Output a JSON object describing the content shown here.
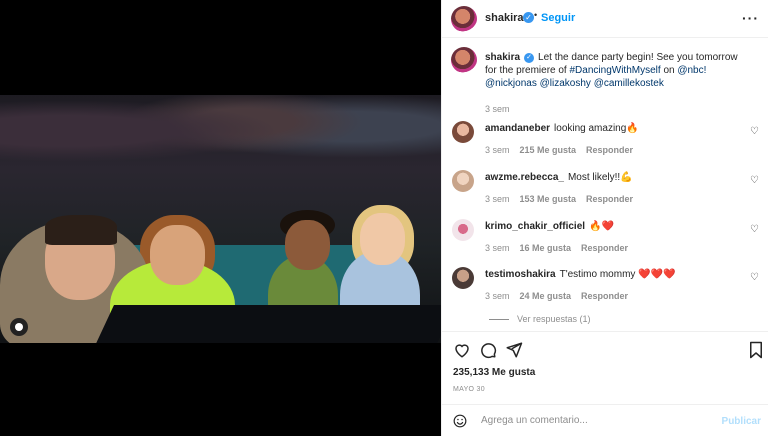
{
  "post": {
    "username": "shakira",
    "follow_label": "Seguir",
    "separator": "•",
    "more_label": "···"
  },
  "caption": {
    "username": "shakira",
    "text": "Let the dance party begin! See you tomorrow for the premiere of",
    "hashtag": "#DancingWithMyself",
    "on": "on",
    "mention_nbc": "@nbc!",
    "mention_nick": "@nickjonas",
    "mention_liza": "@lizakoshy",
    "mention_camille": "@camillekostek",
    "time": "3 sem"
  },
  "comments": [
    {
      "user": "amandaneber",
      "text": "looking amazing🔥",
      "time": "3 sem",
      "likes": "215 Me gusta",
      "reply": "Responder"
    },
    {
      "user": "awzme.rebecca_",
      "text": "Most likely!!💪",
      "time": "3 sem",
      "likes": "153 Me gusta",
      "reply": "Responder"
    },
    {
      "user": "krimo_chakir_officiel",
      "text": "🔥❤️",
      "time": "3 sem",
      "likes": "16 Me gusta",
      "reply": "Responder"
    },
    {
      "user": "testimoshakira",
      "text": "T'estimo mommy ❤️❤️❤️",
      "time": "3 sem",
      "likes": "24 Me gusta",
      "reply": "Responder"
    }
  ],
  "view_replies": "Ver respuestas (1)",
  "likes_count": "235,133 Me gusta",
  "date": "MAYO 30",
  "add_comment": {
    "placeholder": "Agrega un comentario...",
    "publish": "Publicar"
  },
  "icons": {
    "verified": "✓",
    "heart": "♡"
  },
  "colors": {
    "accent": "#0095f6",
    "verified": "#3897f0",
    "link": "#00376b",
    "muted": "#8e8e8e",
    "publish_disabled": "#b2dffc"
  }
}
